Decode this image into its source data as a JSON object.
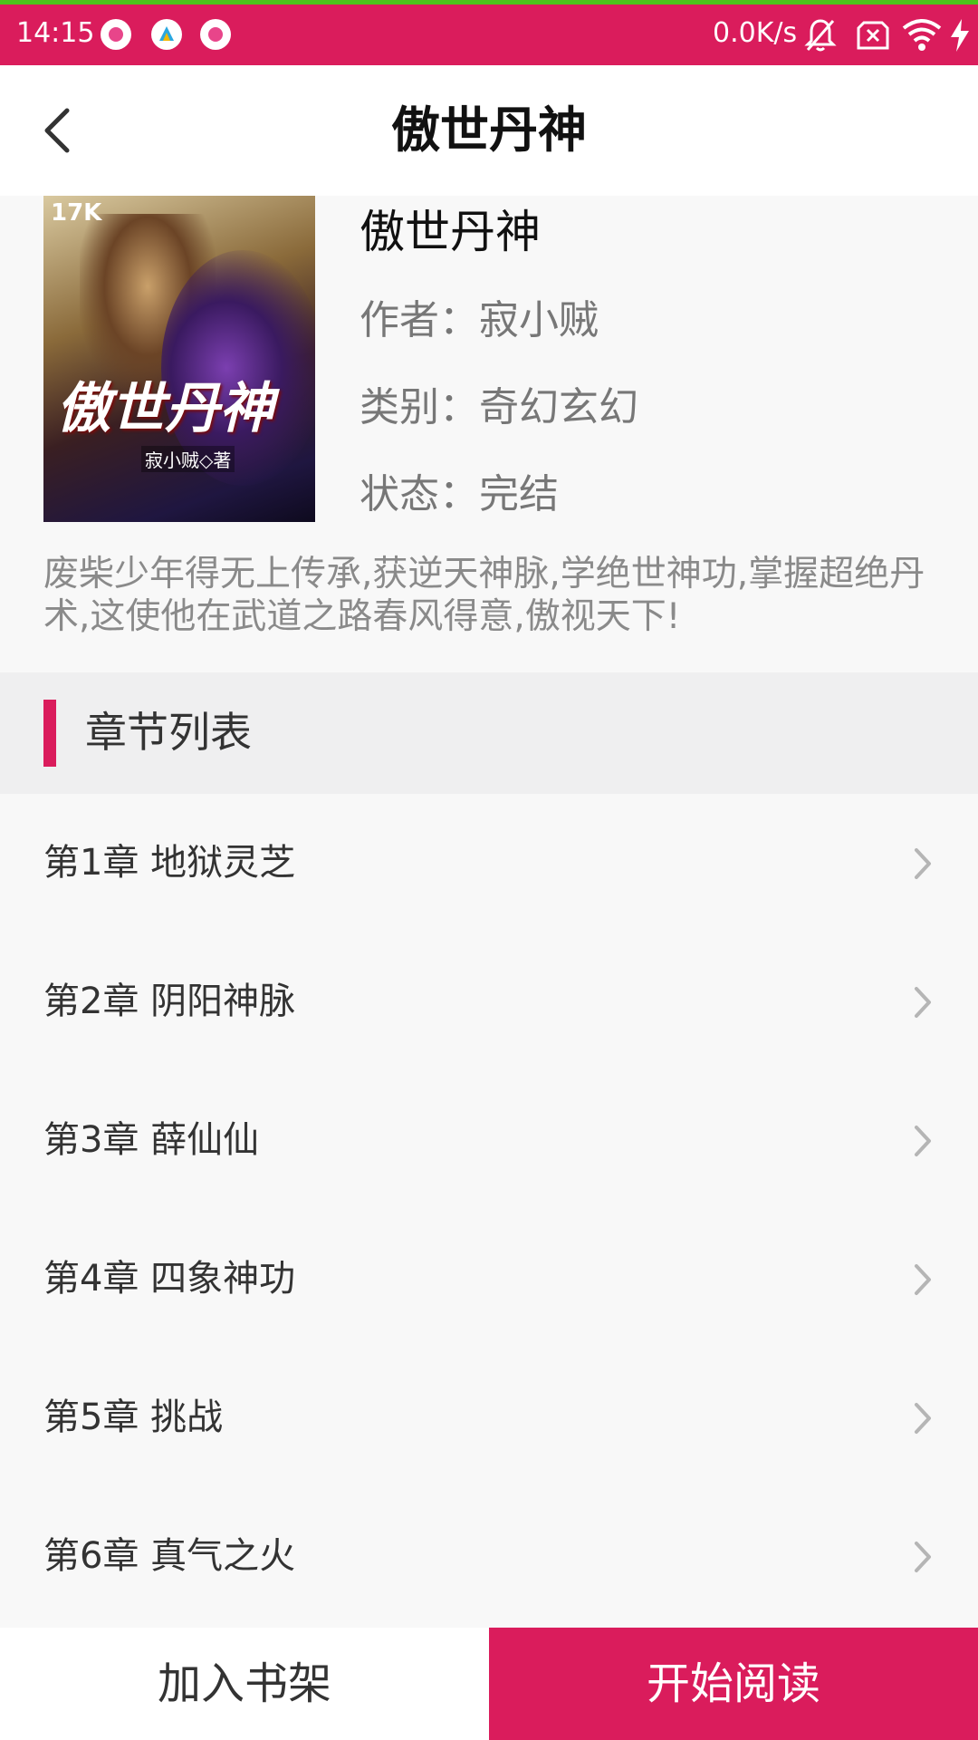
{
  "status_bar": {
    "time": "14:15",
    "net_speed": "0.0K/s",
    "notification_icons": [
      "app-notification-icon",
      "app-notification-icon",
      "app-notification-icon"
    ],
    "right_icons": [
      "bell-off-icon",
      "sim-x-icon",
      "wifi-icon",
      "charging-icon"
    ],
    "background_color": "#da1c5c",
    "top_line_color": "#4cc21b"
  },
  "header": {
    "title": "傲世丹神",
    "back_icon": "back-arrow-icon"
  },
  "book": {
    "cover": {
      "brand": "17K",
      "title": "傲世丹神",
      "author_line": "寂小贼◇著"
    },
    "name": "傲世丹神",
    "author_label": "作者：",
    "author": "寂小贼",
    "category_label": "类别：",
    "category": "奇幻玄幻",
    "status_label": "状态：",
    "status": "完结",
    "description": "废柴少年得无上传承,获逆天神脉,学绝世神功,掌握超绝丹术,这使他在武道之路春风得意,傲视天下!"
  },
  "chapter_section": {
    "title": "章节列表",
    "accent_color": "#da1c5c"
  },
  "chapters": [
    {
      "label": "第1章 地狱灵芝"
    },
    {
      "label": "第2章 阴阳神脉"
    },
    {
      "label": "第3章 薛仙仙"
    },
    {
      "label": "第4章 四象神功"
    },
    {
      "label": "第5章 挑战"
    },
    {
      "label": "第6章 真气之火"
    }
  ],
  "footer": {
    "add_to_shelf": "加入书架",
    "start_reading": "开始阅读",
    "accent_color": "#da1c5c"
  }
}
